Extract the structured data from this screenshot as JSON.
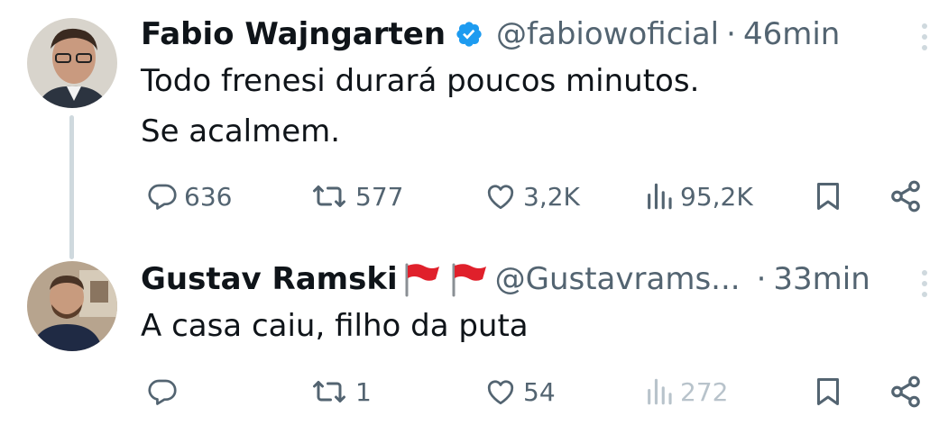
{
  "tweets": [
    {
      "name": "Fabio Wajngarten",
      "handle": "@fabiowoficial",
      "separator": "·",
      "time": "46min",
      "text_lines": [
        "Todo frenesi durará poucos minutos.",
        "Se acalmem."
      ],
      "stats": {
        "replies": "636",
        "retweets": "577",
        "likes": "3,2K",
        "views": "95,2K"
      },
      "verified": true
    },
    {
      "name": "Gustav Ramski",
      "handle": "@Gustavrams...",
      "separator": "·",
      "time": "33min",
      "text_lines": [
        "A casa caiu, filho da puta"
      ],
      "stats": {
        "replies": "",
        "retweets": "1",
        "likes": "54",
        "views": "272"
      },
      "name_emoji": "red-flag-emoji x2"
    }
  ],
  "colors": {
    "text": "#0f1419",
    "secondary": "#536471",
    "verified_blue": "#1d9bf0",
    "thread_line": "#cfd9de",
    "flag_red": "#e0202b"
  },
  "icons": [
    "reply-icon",
    "retweet-icon",
    "like-icon",
    "views-icon",
    "bookmark-icon",
    "share-icon",
    "verified-badge-icon",
    "more-icon",
    "red-flag-emoji"
  ]
}
